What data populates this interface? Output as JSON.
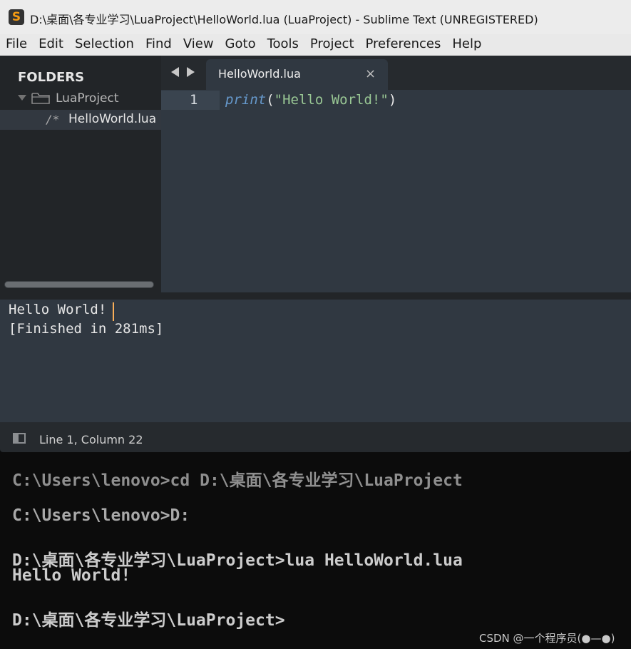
{
  "window": {
    "title": "D:\\桌面\\各专业学习\\LuaProject\\HelloWorld.lua (LuaProject) - Sublime Text (UNREGISTERED)",
    "app_icon": "sublime-text-icon"
  },
  "menu": [
    "File",
    "Edit",
    "Selection",
    "Find",
    "View",
    "Goto",
    "Tools",
    "Project",
    "Preferences",
    "Help"
  ],
  "sidebar": {
    "header": "FOLDERS",
    "folder": "LuaProject",
    "file_icon": "/*",
    "file": "HelloWorld.lua"
  },
  "tabs": [
    {
      "label": "HelloWorld.lua",
      "close": "×"
    }
  ],
  "editor": {
    "line_number": "1",
    "code": {
      "keyword": "print",
      "open": "(",
      "string": "\"Hello World!\"",
      "close": ")"
    }
  },
  "output": {
    "line1": "Hello World!",
    "line2": "[Finished in 281ms]"
  },
  "status": {
    "position": "Line 1, Column 22"
  },
  "console": [
    "C:\\Users\\lenovo>cd D:\\桌面\\各专业学习\\LuaProject",
    "C:\\Users\\lenovo>D:",
    "D:\\桌面\\各专业学习\\LuaProject>lua HelloWorld.lua",
    "Hello World!",
    "D:\\桌面\\各专业学习\\LuaProject>"
  ],
  "watermark": "CSDN @一个程序员(●—●)",
  "colors": {
    "keyword": "#6699cc",
    "string": "#99c794",
    "caret": "#f9ae58",
    "editor_bg": "#303841",
    "sidebar_bg": "#222528",
    "icon_orange": "#f59b12"
  }
}
